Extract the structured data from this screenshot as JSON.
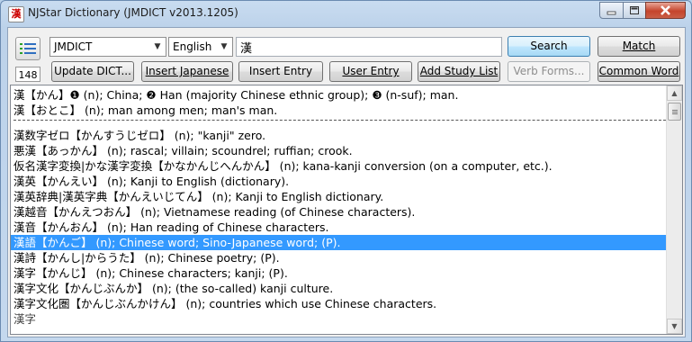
{
  "window": {
    "title": "NJStar Dictionary (JMDICT v2013.1205)",
    "icon": "app-icon"
  },
  "toolbar": {
    "dict_select": "JMDICT",
    "lang_select": "English",
    "search_value": "漢",
    "count": "148",
    "search_label": "Search",
    "match_label": "Match",
    "update_label": "Update DICT...",
    "insert_japanese_label": "Insert Japanese",
    "insert_entry_label": "Insert Entry",
    "user_entry_label": "User Entry",
    "add_study_label": "Add Study List",
    "verb_forms_label": "Verb Forms...",
    "common_word_label": "Common Word"
  },
  "results": {
    "top": [
      "漢【かん】❶ (n); China; ❷ Han (majority Chinese ethnic group); ❸ (n-suf); man.",
      "漢【おとこ】 (n); man among men; man's man."
    ],
    "list": [
      "漢数字ゼロ【かんすうじゼロ】 (n); \"kanji\" zero.",
      "悪漢【あっかん】 (n); rascal; villain; scoundrel; ruffian; crook.",
      "仮名漢字変換|かな漢字変換【かなかんじへんかん】 (n); kana-kanji conversion (on a computer, etc.).",
      "漢英【かんえい】 (n); Kanji to English (dictionary).",
      "漢英辞典|漢英字典【かんえいじてん】 (n); Kanji to English dictionary.",
      "漢越音【かんえつおん】 (n); Vietnamese reading (of Chinese characters).",
      "漢音【かんおん】 (n); Han reading of Chinese characters.",
      "漢語【かんご】 (n); Chinese word; Sino-Japanese word; (P).",
      "漢詩【かんし|からうた】 (n); Chinese poetry; (P).",
      "漢字【かんじ】 (n); Chinese characters; kanji; (P).",
      "漢字文化【かんじぶんか】 (n); (the so-called) kanji culture.",
      "漢字文化圏【かんじぶんかけん】 (n); countries which use Chinese characters."
    ],
    "selected_index": 7
  }
}
